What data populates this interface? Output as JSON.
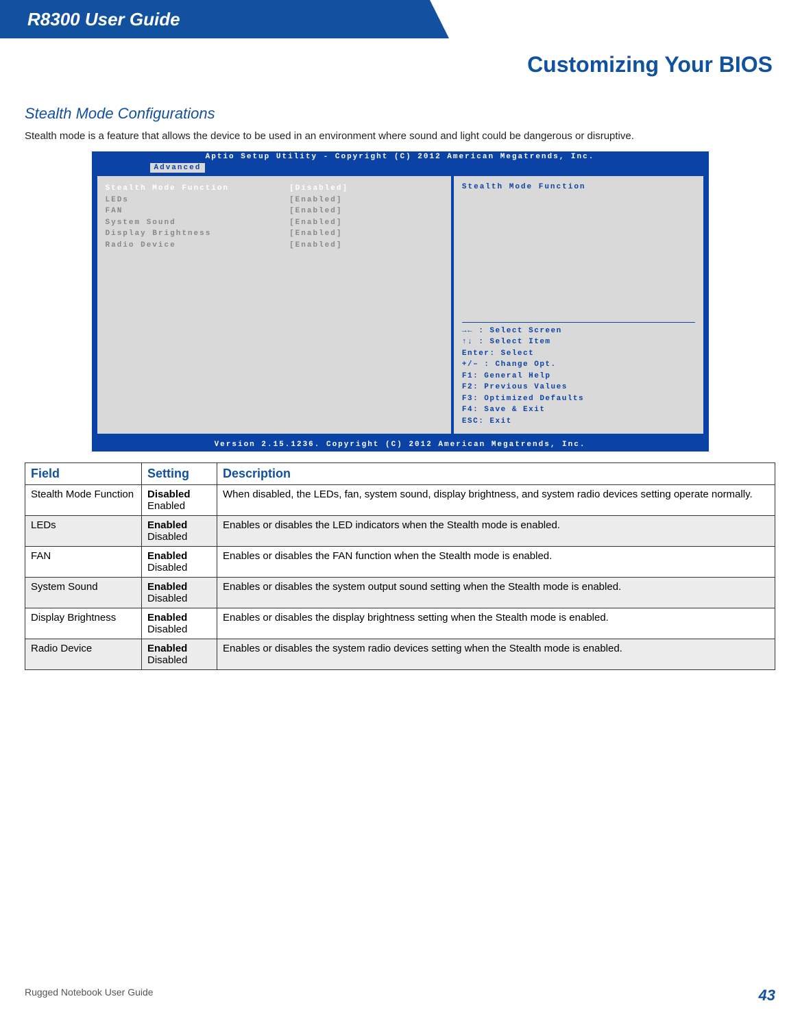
{
  "header": {
    "guide_title": "R8300 User Guide",
    "page_title": "Customizing Your BIOS"
  },
  "section": {
    "heading": "Stealth Mode Configurations",
    "intro": "Stealth mode is a feature that allows the device to be used in an environment where sound and light could be dangerous or disruptive."
  },
  "bios": {
    "top_bar": "Aptio Setup Utility - Copyright (C) 2012 American Megatrends, Inc.",
    "tab": "Advanced",
    "rows": [
      {
        "label": "Stealth Mode Function",
        "value": "[Disabled]",
        "selected": true
      },
      {
        "label": "LEDs",
        "value": "[Enabled]",
        "selected": false
      },
      {
        "label": "FAN",
        "value": "[Enabled]",
        "selected": false
      },
      {
        "label": "System Sound",
        "value": "[Enabled]",
        "selected": false
      },
      {
        "label": "Display Brightness",
        "value": "[Enabled]",
        "selected": false
      },
      {
        "label": "Radio Device",
        "value": "[Enabled]",
        "selected": false
      }
    ],
    "side_title": "Stealth Mode Function",
    "help_lines": [
      "→← : Select Screen",
      "↑↓ : Select Item",
      "Enter: Select",
      "+/– : Change Opt.",
      "F1: General Help",
      "F2: Previous Values",
      "F3: Optimized Defaults",
      "F4: Save & Exit",
      "ESC: Exit"
    ],
    "footer": "Version 2.15.1236. Copyright (C) 2012 American Megatrends, Inc."
  },
  "table": {
    "headers": {
      "field": "Field",
      "setting": "Setting",
      "description": "Description"
    },
    "rows": [
      {
        "field": "Stealth Mode Function",
        "default": "Disabled",
        "other": "Enabled",
        "desc": "When disabled, the LEDs, fan, system sound, display brightness, and system radio devices setting operate normally."
      },
      {
        "field": "LEDs",
        "default": "Enabled",
        "other": "Disabled",
        "desc": "Enables or disables the LED indicators when the Stealth mode is enabled."
      },
      {
        "field": "FAN",
        "default": "Enabled",
        "other": "Disabled",
        "desc": "Enables or disables the FAN function when the Stealth mode is enabled."
      },
      {
        "field": "System Sound",
        "default": "Enabled",
        "other": "Disabled",
        "desc": "Enables or disables the system output sound setting when the Stealth mode is enabled."
      },
      {
        "field": "Display Brightness",
        "default": "Enabled",
        "other": "Disabled",
        "desc": "Enables or disables the display brightness setting when the Stealth mode is enabled."
      },
      {
        "field": "Radio Device",
        "default": "Enabled",
        "other": "Disabled",
        "desc": "Enables or disables the system radio devices setting when the Stealth mode is enabled."
      }
    ]
  },
  "footer": {
    "left": "Rugged Notebook User Guide",
    "page_number": "43"
  }
}
